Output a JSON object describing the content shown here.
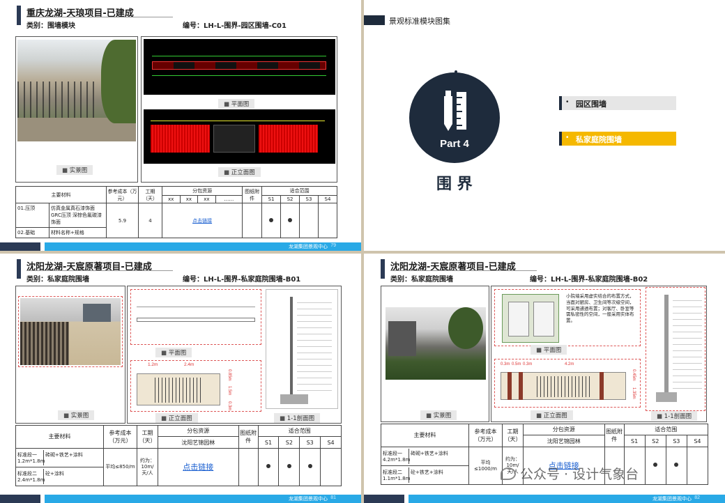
{
  "p1": {
    "title": "重庆龙湖-天琅项目-已建成",
    "category": "类别：围墙模块",
    "code": "编号：LH-L-围界-园区围墙-C01",
    "cap_photo": "实景图",
    "cap_plan": "平面图",
    "cap_elev": "正立面图",
    "table": {
      "h_material": "主要材料",
      "h_cost": "参考成本（万元）",
      "h_period": "工期（天）",
      "h_sub": "分包资源",
      "sub": [
        "xx",
        "xx",
        "xx",
        "……"
      ],
      "h_att": "图纸附件",
      "h_scope": "适合范围",
      "scope": [
        "S1",
        "S2",
        "S3",
        "S4"
      ],
      "r1_name": "01.压顶",
      "r1_mat": "仿真金属真石漆饰面 GRC压顶 深棕色氟碳漆饰面",
      "r2_name": "02.基础",
      "r2_mat": "材料名称+规格",
      "cost": "5.9",
      "period": "4",
      "link": "点击链接"
    },
    "footer": "龙湖集团景观中心",
    "page_no": "79"
  },
  "p2": {
    "header": "景观标准模块图集",
    "part": "Part 4",
    "big": "围 界",
    "item1": "园区围墙",
    "item2": "私家庭院围墙",
    "colors": {
      "navy": "#1e2b3c",
      "yellow": "#f5b800",
      "grey": "#e6e6e6"
    }
  },
  "p3": {
    "title": "沈阳龙湖-天宸原著项目-已建成",
    "category": "类别：私家庭院围墙",
    "code": "编号：LH-L-围界-私家庭院围墙-B01",
    "cap_photo": "实景图",
    "cap_plan": "平面图",
    "cap_elev": "正立面图",
    "cap_sec": "1-1剖面图",
    "dims": [
      "1.2m",
      "2.4m",
      "0.85m",
      "1.5m",
      "0.3m"
    ],
    "table": {
      "h_material": "主要材料",
      "h_cost": "参考成本（万元）",
      "h_period": "工期（天）",
      "h_sub": "分包资源",
      "sub": "沈阳艺锦园林",
      "h_att": "图纸附件",
      "h_scope": "适合范围",
      "scope": [
        "S1",
        "S2",
        "S3",
        "S4"
      ],
      "r1_name": "标准段一 1.2m*1.8m",
      "r1_mat": "砖砌+铁艺+涂料",
      "r2_name": "标准段二 2.4m*1.8m",
      "r2_mat": "砼+涂料",
      "cost": "平均≤850/m",
      "period": "约为：10m/天/人",
      "link": "点击链接"
    },
    "footer": "龙湖集团景观中心",
    "page_no": "81"
  },
  "p4": {
    "title": "沈阳龙湖-天宸原著项目-已建成",
    "category": "类别：私家庭院围墙",
    "code": "编号：LH-L-围界-私家庭院围墙-B02",
    "note": "小院墙采用虚实结合的布置方式，当面对厨房、卫生间等次级空间，可采用通透布置；对客厅、卧室等需私密性的空间，一般采用实体布置。",
    "cap_photo": "实景图",
    "cap_plan": "平面图",
    "cap_elev": "正立面图",
    "cap_sec": "1-1剖面图",
    "dims": [
      "0.3m",
      "0.5m",
      "0.3m",
      "4.2m",
      "0.45m",
      "1.35m"
    ],
    "table": {
      "h_material": "主要材料",
      "h_cost": "参考成本（万元）",
      "h_period": "工期（天）",
      "h_sub": "分包资源",
      "sub": "沈阳艺锦园林",
      "h_att": "图纸附件",
      "h_scope": "适合范围",
      "scope": [
        "S1",
        "S2",
        "S3",
        "S4"
      ],
      "r1_name": "标准段一 4.2m*1.8m",
      "r1_mat": "砖砌+铁艺+涂料",
      "r2_name": "标准段二 1.1m*1.8m",
      "r2_mat": "砼+铁艺+涂料",
      "cost": "平均≤1000/m",
      "period": "约为：10m/天/人",
      "link": "点击链接"
    },
    "footer": "龙湖集团景观中心",
    "page_no": "82",
    "watermark": "公众号 · 设计气象台"
  }
}
